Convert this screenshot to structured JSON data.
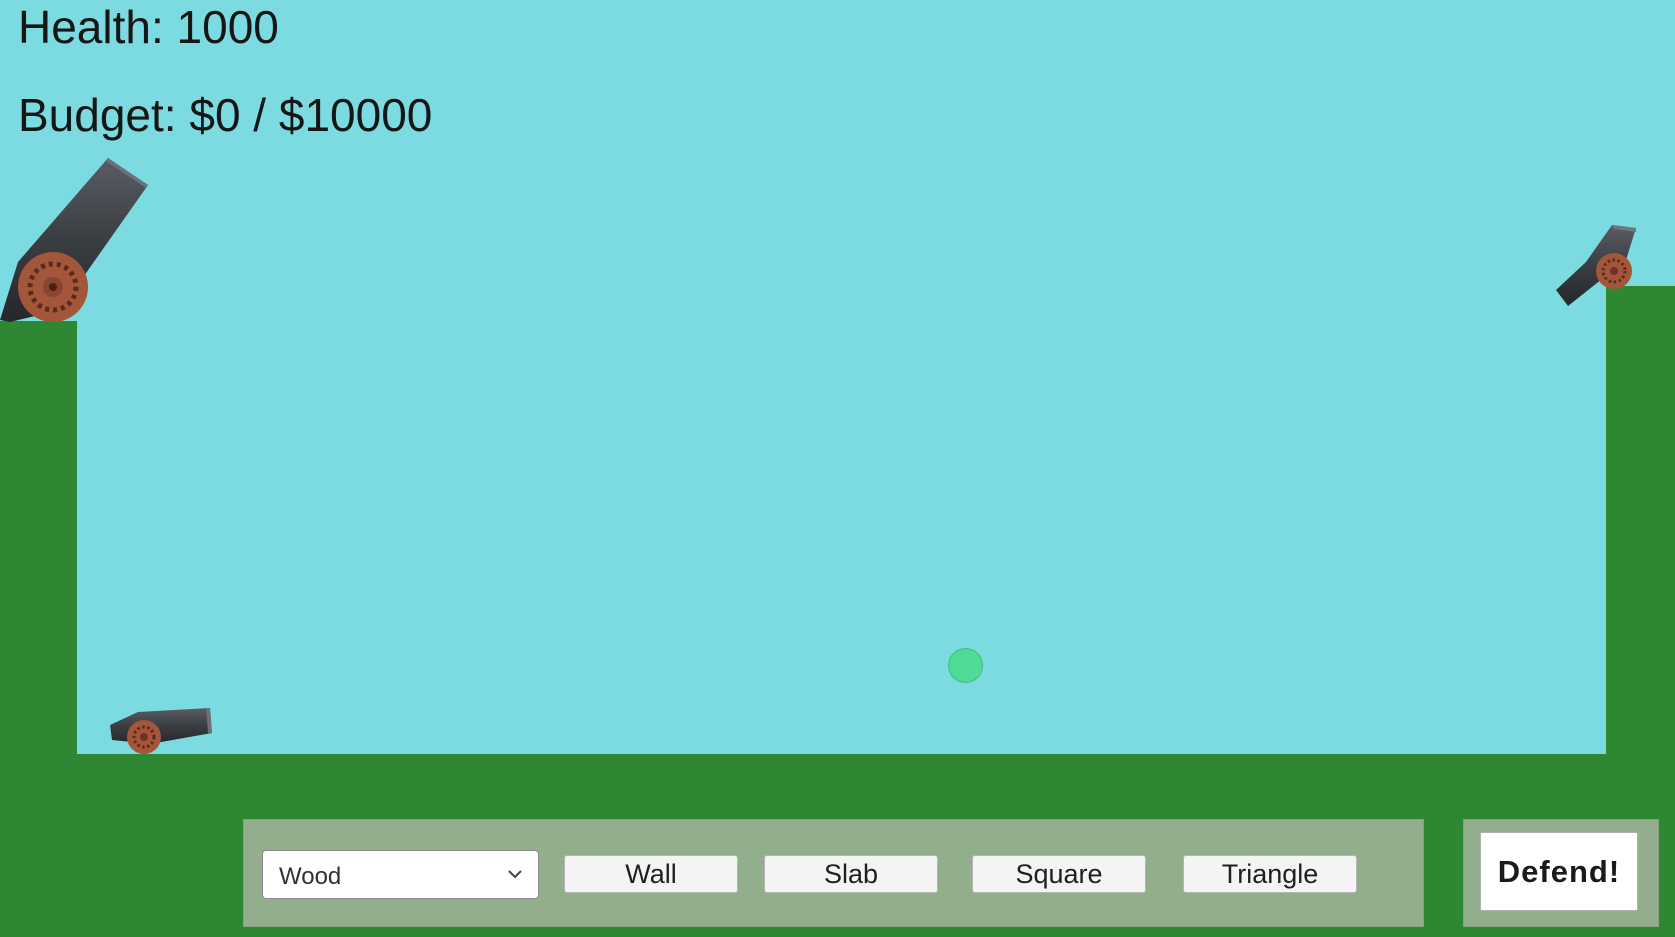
{
  "hud": {
    "health": "Health: 1000",
    "budget": "Budget: $0 / $10000"
  },
  "build_panel": {
    "material_selected": "Wood",
    "shape_buttons": [
      "Wall",
      "Slab",
      "Square",
      "Triangle"
    ]
  },
  "defend_button": "Defend!",
  "colors": {
    "sky": "#7bdbe0",
    "ground": "#2e8833",
    "panel": "#92ae8c",
    "cannon_barrel": "#3c3f45",
    "cannon_wheel": "#a4563a",
    "target_ball": "#4fdb95"
  },
  "icons": {
    "dropdown": "chevron-down-icon"
  }
}
